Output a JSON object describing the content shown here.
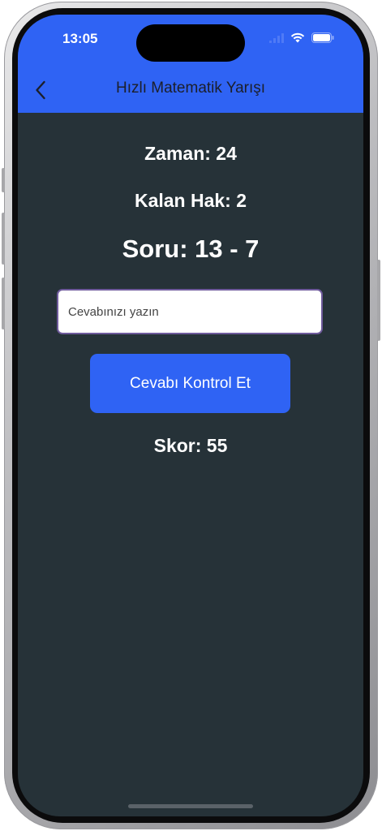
{
  "status_bar": {
    "time": "13:05",
    "icons": [
      "cellular-signal-icon",
      "wifi-icon",
      "battery-icon"
    ]
  },
  "app_bar": {
    "back_icon": "chevron-left-icon",
    "title": "Hızlı Matematik Yarışı"
  },
  "game": {
    "timer": "Zaman: 24",
    "lives": "Kalan Hak: 2",
    "question": "Soru: 13 - 7",
    "answer_placeholder": "Cevabınızı yazın",
    "answer_value": "",
    "check_button_label": "Cevabı Kontrol Et",
    "score": "Skor: 55"
  },
  "colors": {
    "app_bar": "#2f63f4",
    "background": "#263238",
    "button": "#2f63f4",
    "text": "#ffffff"
  }
}
